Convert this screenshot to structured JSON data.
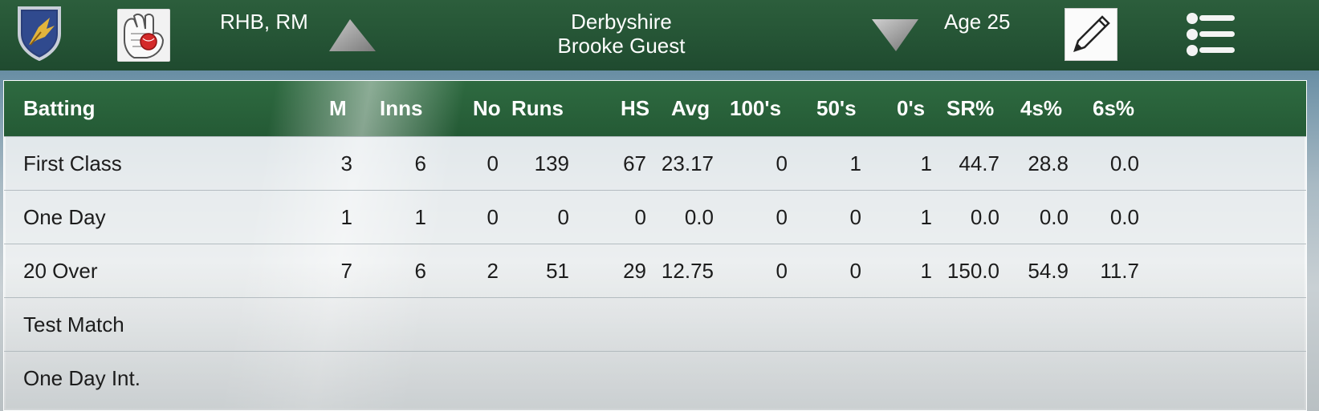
{
  "header": {
    "batting_style": "RHB, RM",
    "team": "Derbyshire",
    "player_name": "Brooke Guest",
    "age": "Age 25"
  },
  "icons": {
    "team_badge": "shield-crest-icon",
    "role": "wicketkeeper-gloves-icon",
    "prev": "up-triangle-icon",
    "next": "down-triangle-icon",
    "edit": "pencil-icon",
    "menu": "menu-icon"
  },
  "colors": {
    "header_green": "#245a35",
    "panel_bg": "#f6f7f7",
    "text": "#1c1c1c"
  },
  "table": {
    "columns": [
      "Batting",
      "M",
      "Inns",
      "No",
      "Runs",
      "HS",
      "Avg",
      "100's",
      "50's",
      "0's",
      "SR%",
      "4s%",
      "6s%"
    ],
    "rows": [
      {
        "format": "First Class",
        "values": [
          "3",
          "6",
          "0",
          "139",
          "67",
          "23.17",
          "0",
          "1",
          "1",
          "44.7",
          "28.8",
          "0.0"
        ]
      },
      {
        "format": "One Day",
        "values": [
          "1",
          "1",
          "0",
          "0",
          "0",
          "0.0",
          "0",
          "0",
          "1",
          "0.0",
          "0.0",
          "0.0"
        ]
      },
      {
        "format": "20 Over",
        "values": [
          "7",
          "6",
          "2",
          "51",
          "29",
          "12.75",
          "0",
          "0",
          "1",
          "150.0",
          "54.9",
          "11.7"
        ]
      },
      {
        "format": "Test Match",
        "values": []
      },
      {
        "format": "One Day Int.",
        "values": []
      }
    ]
  }
}
